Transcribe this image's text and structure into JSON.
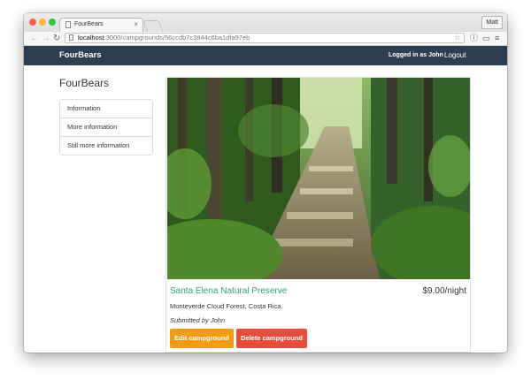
{
  "browser": {
    "tab_title": "FourBears",
    "tab_close": "×",
    "user_button": "Matt",
    "url_host": "localhost",
    "url_path": ":3000/campgrounds/56ccdb7c3844c6ba1dfa97eb",
    "traffic_colors": [
      "#fd5f57",
      "#febc2e",
      "#28c840"
    ]
  },
  "navbar": {
    "brand": "FourBears",
    "logged_in": "Logged in as John",
    "logout": "Logout",
    "bg_color": "#2c3e50"
  },
  "sidebar": {
    "title": "FourBears",
    "items": [
      {
        "label": "Information"
      },
      {
        "label": "More information"
      },
      {
        "label": "Still more information"
      }
    ]
  },
  "campground": {
    "name": "Santa Elena Natural Preserve",
    "price": "$9.00/night",
    "description": "Monteverde Cloud Forest, Costa Rica.",
    "submitted_by": "Submitted by John",
    "name_color": "#2aa37c"
  },
  "actions": {
    "edit_label": "Edit campground",
    "delete_label": "Delete campground",
    "edit_color": "#f39c12",
    "delete_color": "#e74c3c"
  }
}
